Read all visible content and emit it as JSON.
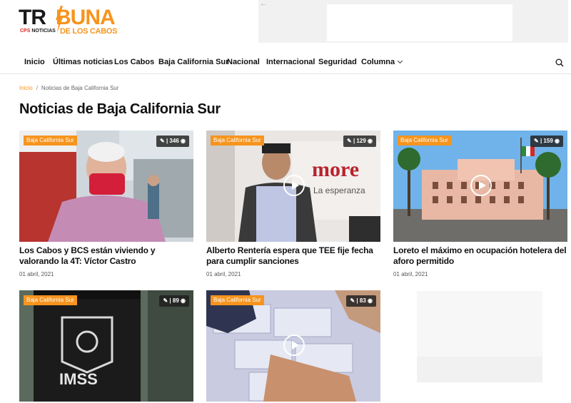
{
  "header": {
    "logo": {
      "tri": "TR",
      "buna": "BUNA",
      "sub_left_brand": "CPS",
      "sub_left": "NOTICIAS",
      "sub_right": "DE LOS CABOS"
    }
  },
  "nav": {
    "items": [
      {
        "label": "Inicio"
      },
      {
        "label": "Últimas noticias"
      },
      {
        "label": "Los Cabos"
      },
      {
        "label": "Baja California Sur"
      },
      {
        "label": "Nacional"
      },
      {
        "label": "Internacional"
      },
      {
        "label": "Seguridad"
      },
      {
        "label": "Columna",
        "has_dropdown": true
      }
    ],
    "search_icon": "search-icon"
  },
  "breadcrumb": {
    "home": "Inicio",
    "separator": "/",
    "current": "Noticias de Baja California Sur"
  },
  "page_title": "Noticias de Baja California Sur",
  "colors": {
    "accent": "#f7941d",
    "text": "#111111",
    "badge_bg": "#f7941d"
  },
  "articles": [
    {
      "category": "Baja California Sur",
      "views": "346",
      "title": "Los Cabos y BCS están viviendo y valorando la 4T: Víctor Castro",
      "date": "01 abril, 2021",
      "video": false
    },
    {
      "category": "Baja California Sur",
      "views": "129",
      "title": "Alberto Rentería espera que TEE fije fecha para cumplir sanciones",
      "date": "01 abril, 2021",
      "video": true
    },
    {
      "category": "Baja California Sur",
      "views": "159",
      "title": "Loreto el máximo en ocupación hotelera del aforo permitido",
      "date": "01 abril, 2021",
      "video": true
    },
    {
      "category": "Baja California Sur",
      "views": "89",
      "title": "",
      "date": "",
      "video": false
    },
    {
      "category": "Baja California Sur",
      "views": "83",
      "title": "",
      "date": "",
      "video": true
    }
  ]
}
